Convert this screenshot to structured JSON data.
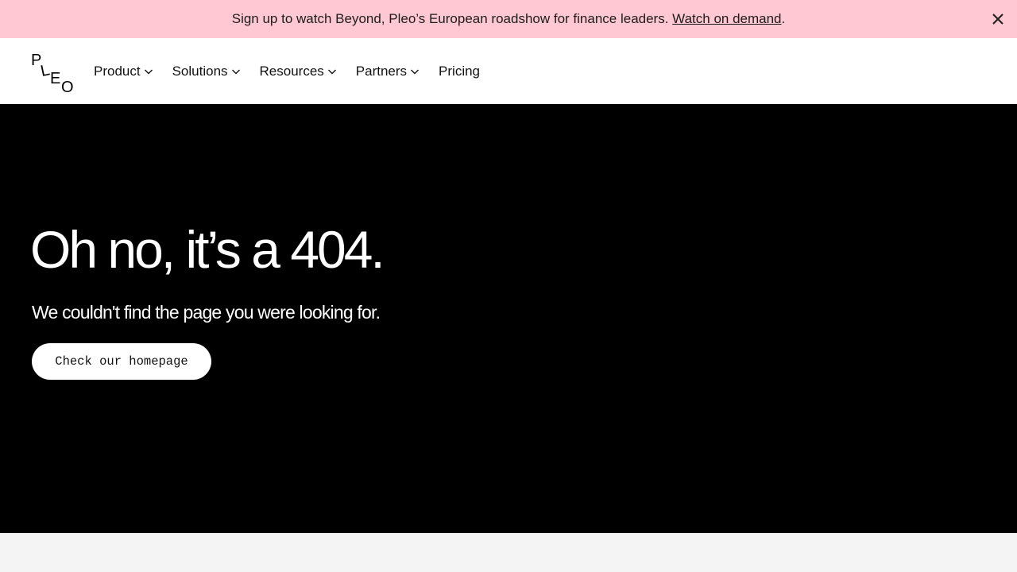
{
  "banner": {
    "text": "Sign up to watch Beyond, Pleo’s European roadshow for finance leaders. ",
    "link_label": "Watch on demand",
    "trailing": ".",
    "background": "#ffc8d2",
    "close_icon": "close-icon"
  },
  "nav": {
    "logo_alt": "Pleo",
    "logo_letters": [
      "P",
      "L",
      "E",
      "O"
    ],
    "items": [
      {
        "label": "Product",
        "has_dropdown": true
      },
      {
        "label": "Solutions",
        "has_dropdown": true
      },
      {
        "label": "Resources",
        "has_dropdown": true
      },
      {
        "label": "Partners",
        "has_dropdown": true
      },
      {
        "label": "Pricing",
        "has_dropdown": false
      }
    ]
  },
  "hero": {
    "title": "Oh no, it’s a 404.",
    "subtitle": "We couldn't find the page you were looking for.",
    "cta_label": "Check our homepage",
    "background": "#000000",
    "text_color": "#ffffff"
  }
}
